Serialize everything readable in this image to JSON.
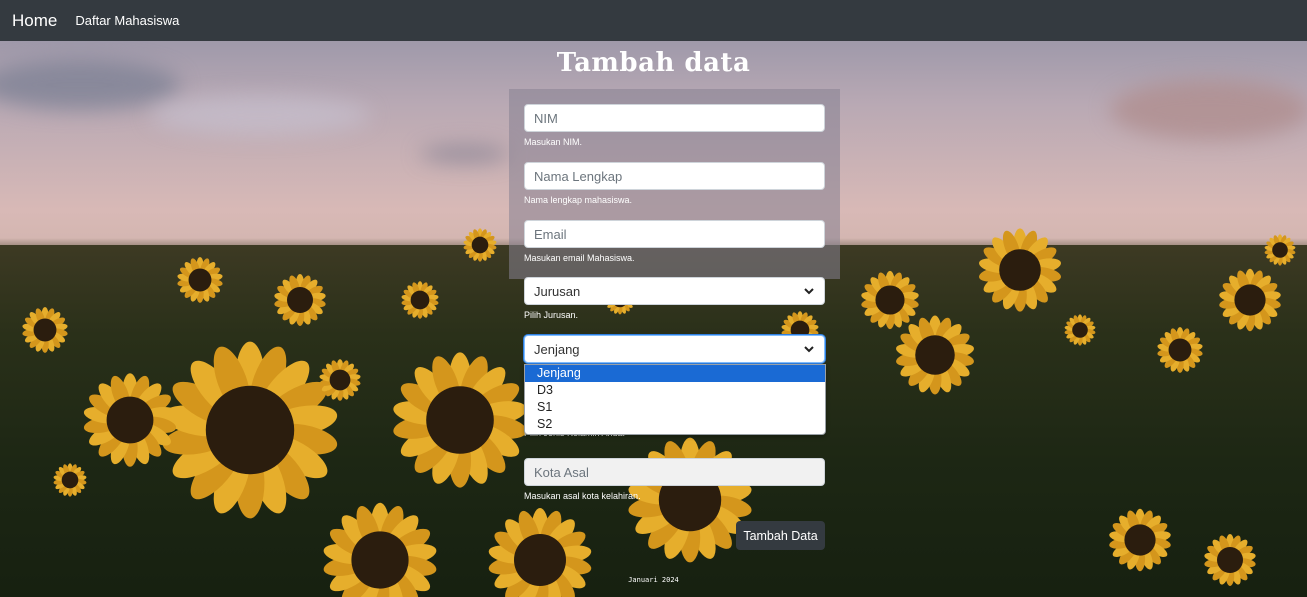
{
  "navbar": {
    "brand": "Home",
    "link": "Daftar Mahasiswa"
  },
  "page_title": "Tambah data",
  "form": {
    "nim": {
      "placeholder": "NIM",
      "help": "Masukan NIM."
    },
    "nama": {
      "placeholder": "Nama Lengkap",
      "help": "Nama lengkap mahasiswa."
    },
    "email": {
      "placeholder": "Email",
      "help": "Masukan email Mahasiswa."
    },
    "jurusan": {
      "selected": "Jurusan",
      "help": "Pilih Jurusan."
    },
    "jenjang": {
      "selected": "Jenjang",
      "options": [
        "Jenjang",
        "D3",
        "S1",
        "S2"
      ],
      "active_option": "Jenjang"
    },
    "jenis_kelamin": {
      "help": "Pilih Jenis Kelamin Anda."
    },
    "kota": {
      "placeholder": "Kota Asal",
      "help": "Masukan asal kota kelahiran."
    },
    "submit_label": "Tambah Data"
  },
  "footer": {
    "text": "Januari 2024"
  },
  "colors": {
    "navbar_bg": "#343a40",
    "button_bg": "#343a40",
    "dropdown_active": "#1a6ad4",
    "text_white": "#ffffff"
  },
  "icons": {
    "select_arrow": "chevron-down-icon"
  }
}
